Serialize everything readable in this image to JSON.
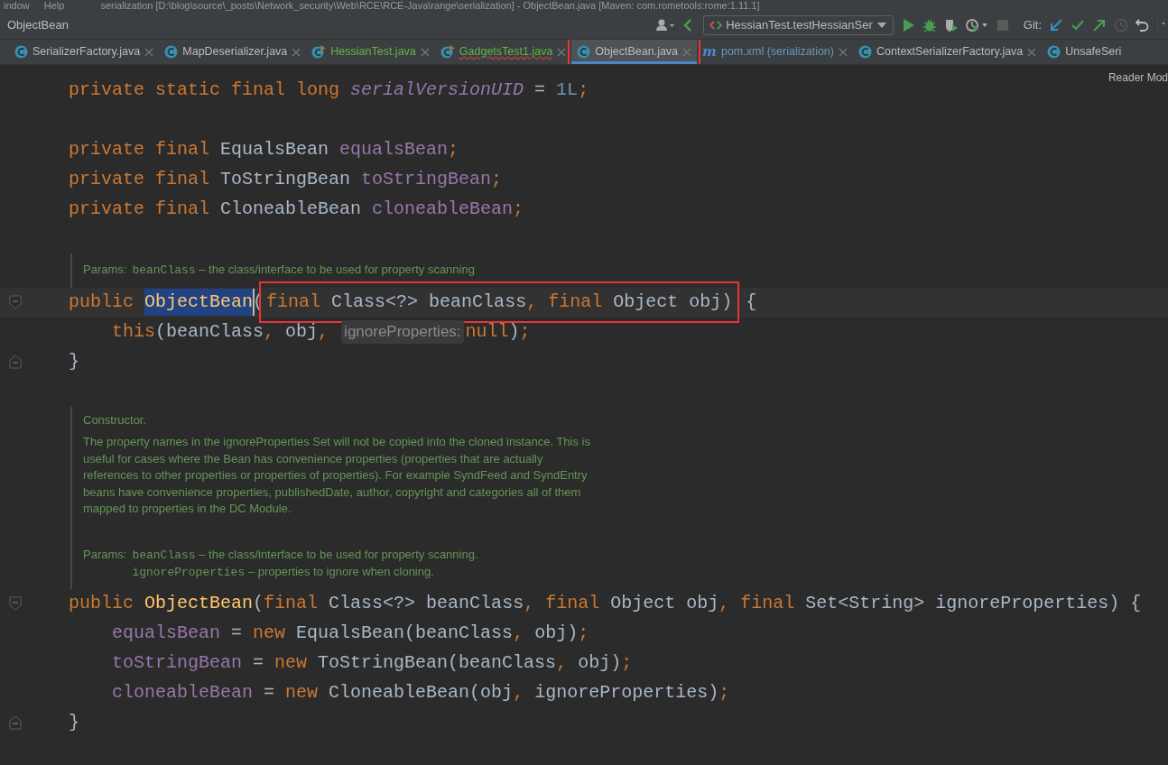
{
  "title_bar": {
    "menu": [
      "indow",
      "Help"
    ],
    "title": "serialization [D:\\blog\\source\\_posts\\Network_security\\Web\\RCE\\RCE-Java\\range\\serialization] - ObjectBean.java [Maven: com.rometools:rome:1.11.1]"
  },
  "nav_bar": {
    "breadcrumb": "ObjectBean",
    "run_config": "HessianTest.testHessianSer",
    "git_label": "Git:"
  },
  "tabs": [
    {
      "label": "SerializerFactory.java",
      "kind": "class",
      "color": "#bbbbbb",
      "selected": false,
      "error": false,
      "boxed": false
    },
    {
      "label": "MapDeserializer.java",
      "kind": "class",
      "color": "#bbbbbb",
      "selected": false,
      "error": false,
      "boxed": false
    },
    {
      "label": "HessianTest.java",
      "kind": "test",
      "color": "#62b543",
      "selected": false,
      "error": false,
      "boxed": false
    },
    {
      "label": "GadgetsTest1.java",
      "kind": "test",
      "color": "#62b543",
      "selected": false,
      "error": true,
      "boxed": false
    },
    {
      "label": "ObjectBean.java",
      "kind": "class",
      "color": "#bbbbbb",
      "selected": true,
      "error": false,
      "boxed": true
    },
    {
      "label": "pom.xml (serialization)",
      "kind": "maven",
      "glyph": "m",
      "color": "#6897bb",
      "selected": false,
      "error": false,
      "boxed": false
    },
    {
      "label": "ContextSerializerFactory.java",
      "kind": "class",
      "color": "#bbbbbb",
      "selected": false,
      "error": false,
      "boxed": false
    },
    {
      "label": "UnsafeSeri",
      "kind": "class",
      "color": "#bbbbbb",
      "selected": false,
      "error": false,
      "boxed": false
    }
  ],
  "reader_mode": "Reader Mod",
  "editor": [
    {
      "kind": "code",
      "segments": [
        {
          "kind": "code",
          "tokens": [
            {
              "kind": "kw",
              "s": "    private static final long "
            },
            {
              "kind": "sfield",
              "s": "serialVersionUID"
            },
            {
              "kind": "plain",
              "s": " = "
            },
            {
              "kind": "num",
              "s": "1L"
            },
            {
              "kind": "kw",
              "s": ";"
            }
          ]
        }
      ]
    },
    {
      "kind": "blank"
    },
    {
      "kind": "code",
      "segments": [
        {
          "kind": "code",
          "tokens": [
            {
              "kind": "kw",
              "s": "    private final "
            },
            {
              "kind": "plain",
              "s": "EqualsBean "
            },
            {
              "kind": "field",
              "s": "equalsBean"
            },
            {
              "kind": "kw",
              "s": ";"
            }
          ]
        }
      ]
    },
    {
      "kind": "code",
      "segments": [
        {
          "kind": "code",
          "tokens": [
            {
              "kind": "kw",
              "s": "    private final "
            },
            {
              "kind": "plain",
              "s": "ToStringBean "
            },
            {
              "kind": "field",
              "s": "toStringBean"
            },
            {
              "kind": "kw",
              "s": ";"
            }
          ]
        }
      ]
    },
    {
      "kind": "code",
      "segments": [
        {
          "kind": "code",
          "tokens": [
            {
              "kind": "kw",
              "s": "    private final "
            },
            {
              "kind": "plain",
              "s": "CloneableBean "
            },
            {
              "kind": "field",
              "s": "cloneableBean"
            },
            {
              "kind": "kw",
              "s": ";"
            }
          ]
        }
      ]
    },
    {
      "kind": "blank"
    },
    {
      "kind": "doc",
      "params": {
        "label": "Params:",
        "items": [
          {
            "name": "beanClass",
            "desc": "– the class/interface to be used for property scanning"
          }
        ]
      }
    },
    {
      "kind": "code",
      "current": true,
      "fold_start": true,
      "segments": [
        {
          "kind": "code",
          "tokens": [
            {
              "kind": "kw",
              "s": "    public "
            }
          ]
        },
        {
          "kind": "selection",
          "caret": true,
          "tokens": [
            {
              "kind": "ctor",
              "s": "ObjectBean"
            }
          ]
        },
        {
          "kind": "code",
          "tokens": [
            {
              "kind": "plain",
              "s": "("
            }
          ]
        },
        {
          "kind": "boxed",
          "tokens": [
            {
              "kind": "kw",
              "s": "final "
            },
            {
              "kind": "plain",
              "s": "Class<?> beanClass"
            },
            {
              "kind": "kw",
              "s": ", final "
            },
            {
              "kind": "plain",
              "s": "Object obj)"
            }
          ]
        },
        {
          "kind": "code",
          "tokens": [
            {
              "kind": "plain",
              "s": " {"
            }
          ]
        }
      ]
    },
    {
      "kind": "code",
      "segments": [
        {
          "kind": "code",
          "tokens": [
            {
              "kind": "kw",
              "s": "        this"
            },
            {
              "kind": "plain",
              "s": "(beanClass"
            },
            {
              "kind": "kw",
              "s": ", "
            },
            {
              "kind": "plain",
              "s": "obj"
            },
            {
              "kind": "kw",
              "s": ", "
            }
          ]
        },
        {
          "kind": "hint",
          "text": "ignoreProperties:"
        },
        {
          "kind": "code",
          "tokens": [
            {
              "kind": "kw",
              "s": "null"
            },
            {
              "kind": "plain",
              "s": ")"
            },
            {
              "kind": "kw",
              "s": ";"
            }
          ]
        }
      ]
    },
    {
      "kind": "code",
      "fold_end": true,
      "segments": [
        {
          "kind": "code",
          "tokens": [
            {
              "kind": "plain",
              "s": "    }"
            }
          ]
        }
      ]
    },
    {
      "kind": "blank"
    },
    {
      "kind": "doc",
      "paragraphs": [
        [
          "Constructor."
        ],
        [
          "The property names in the ignoreProperties Set will not be copied into the cloned instance. This is",
          "useful for cases where the Bean has convenience properties (properties that are actually",
          "references to other properties or properties of properties). For example SyndFeed and SyndEntry",
          "beans have convenience properties, publishedDate, author, copyright and categories all of them",
          "mapped to properties in the DC Module."
        ]
      ],
      "params": {
        "label": "Params:",
        "items": [
          {
            "name": "beanClass",
            "desc": "– the class/interface to be used for property scanning."
          },
          {
            "name": "ignoreProperties",
            "desc": "– properties to ignore when cloning."
          }
        ]
      }
    },
    {
      "kind": "code",
      "fold_start": true,
      "segments": [
        {
          "kind": "code",
          "tokens": [
            {
              "kind": "kw",
              "s": "    public "
            },
            {
              "kind": "ctor",
              "s": "ObjectBean"
            },
            {
              "kind": "plain",
              "s": "("
            },
            {
              "kind": "kw",
              "s": "final "
            },
            {
              "kind": "plain",
              "s": "Class<?> beanClass"
            },
            {
              "kind": "kw",
              "s": ", final "
            },
            {
              "kind": "plain",
              "s": "Object obj"
            },
            {
              "kind": "kw",
              "s": ", final "
            },
            {
              "kind": "plain",
              "s": "Set<String> ignoreProperties) {"
            }
          ]
        }
      ]
    },
    {
      "kind": "code",
      "segments": [
        {
          "kind": "code",
          "tokens": [
            {
              "kind": "field",
              "s": "        equalsBean"
            },
            {
              "kind": "plain",
              "s": " = "
            },
            {
              "kind": "kw",
              "s": "new "
            },
            {
              "kind": "plain",
              "s": "EqualsBean(beanClass"
            },
            {
              "kind": "kw",
              "s": ", "
            },
            {
              "kind": "plain",
              "s": "obj)"
            },
            {
              "kind": "kw",
              "s": ";"
            }
          ]
        }
      ]
    },
    {
      "kind": "code",
      "segments": [
        {
          "kind": "code",
          "tokens": [
            {
              "kind": "field",
              "s": "        toStringBean"
            },
            {
              "kind": "plain",
              "s": " = "
            },
            {
              "kind": "kw",
              "s": "new "
            },
            {
              "kind": "plain",
              "s": "ToStringBean(beanClass"
            },
            {
              "kind": "kw",
              "s": ", "
            },
            {
              "kind": "plain",
              "s": "obj)"
            },
            {
              "kind": "kw",
              "s": ";"
            }
          ]
        }
      ]
    },
    {
      "kind": "code",
      "segments": [
        {
          "kind": "code",
          "tokens": [
            {
              "kind": "field",
              "s": "        cloneableBean"
            },
            {
              "kind": "plain",
              "s": " = "
            },
            {
              "kind": "kw",
              "s": "new "
            },
            {
              "kind": "plain",
              "s": "CloneableBean(obj"
            },
            {
              "kind": "kw",
              "s": ", "
            },
            {
              "kind": "plain",
              "s": "ignoreProperties)"
            },
            {
              "kind": "kw",
              "s": ";"
            }
          ]
        }
      ]
    },
    {
      "kind": "code",
      "fold_end": true,
      "segments": [
        {
          "kind": "code",
          "tokens": [
            {
              "kind": "plain",
              "s": "    }"
            }
          ]
        }
      ]
    }
  ]
}
